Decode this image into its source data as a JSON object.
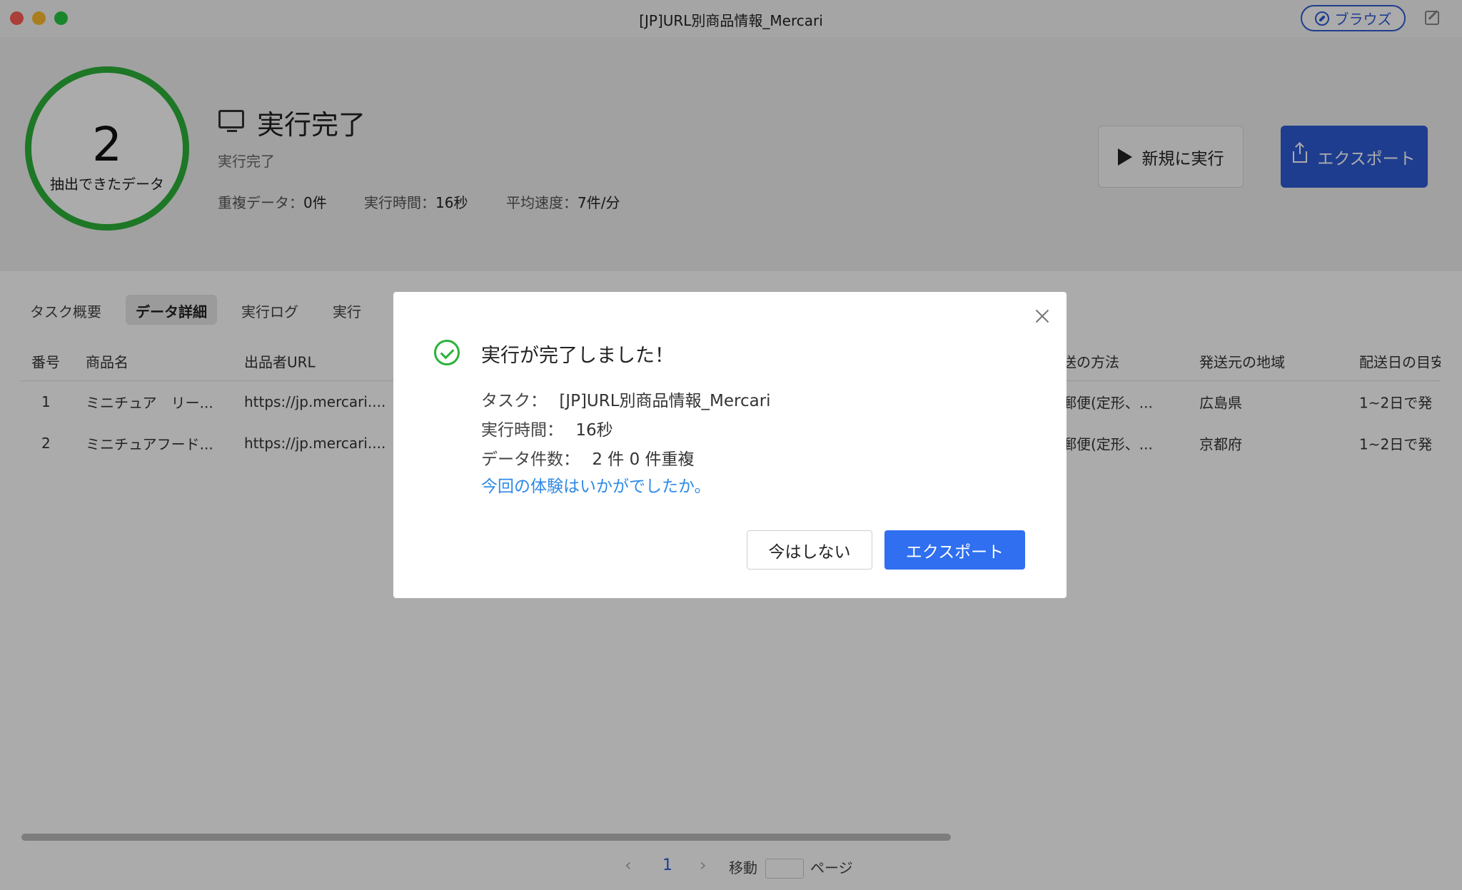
{
  "window": {
    "title": "[JP]URL別商品情報_Mercari",
    "browse_label": "ブラウズ"
  },
  "summary": {
    "count": "2",
    "count_label": "抽出できたデータ",
    "status_title": "実行完了",
    "status_sub": "実行完了",
    "stats": {
      "dup_label": "重複データ：",
      "dup_value": "0件",
      "time_label": "実行時間：",
      "time_value": "16秒",
      "speed_label": "平均速度：",
      "speed_value": "7件/分"
    },
    "run_button": "新規に実行",
    "export_button": "エクスポート"
  },
  "tabs": [
    "タスク概要",
    "データ詳細",
    "実行ログ",
    "実行"
  ],
  "table": {
    "headers": [
      "番号",
      "商品名",
      "出品者URL",
      "送の方法",
      "発送元の地域",
      "配送日の目安"
    ],
    "rows": [
      [
        "1",
        "ミニチュア　リー...",
        "https://jp.mercari....",
        "郵便(定形、...",
        "広島県",
        "1~2日で発"
      ],
      [
        "2",
        "ミニチュアフード...",
        "https://jp.mercari....",
        "郵便(定形、...",
        "京都府",
        "1~2日で発"
      ]
    ]
  },
  "pagination": {
    "prev": "‹",
    "current": "1",
    "next": "›",
    "goto_label": "移動",
    "page_label": "ページ"
  },
  "dialog": {
    "title": "実行が完了しました！",
    "task_label": "タスク：",
    "task_value": "[JP]URL別商品情報_Mercari",
    "time_label": "実行時間：",
    "time_value": "16秒",
    "count_label": "データ件数：",
    "count_value": "2 件 0 件重複",
    "feedback_link": "今回の体験はいかがでしたか。",
    "cancel_button": "今はしない",
    "export_button": "エクスポート"
  }
}
